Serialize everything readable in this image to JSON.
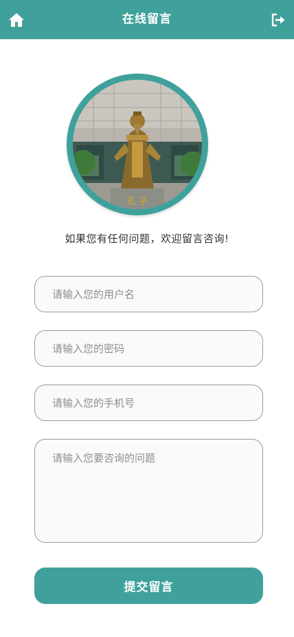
{
  "header": {
    "title": "在线留言",
    "home_icon": "home-icon",
    "logout_icon": "logout-icon"
  },
  "avatar": {
    "plaque_text": "孔 子"
  },
  "intro_text": "如果您有任何问题，欢迎留言咨询!",
  "form": {
    "username_placeholder": "请输入您的用户名",
    "password_placeholder": "请输入您的密码",
    "phone_placeholder": "请输入您的手机号",
    "question_placeholder": "请输入您要咨询的问题",
    "submit_label": "提交留言"
  },
  "colors": {
    "accent": "#40a19c",
    "field_border": "#9a9a9a",
    "field_background": "#fafafa"
  }
}
